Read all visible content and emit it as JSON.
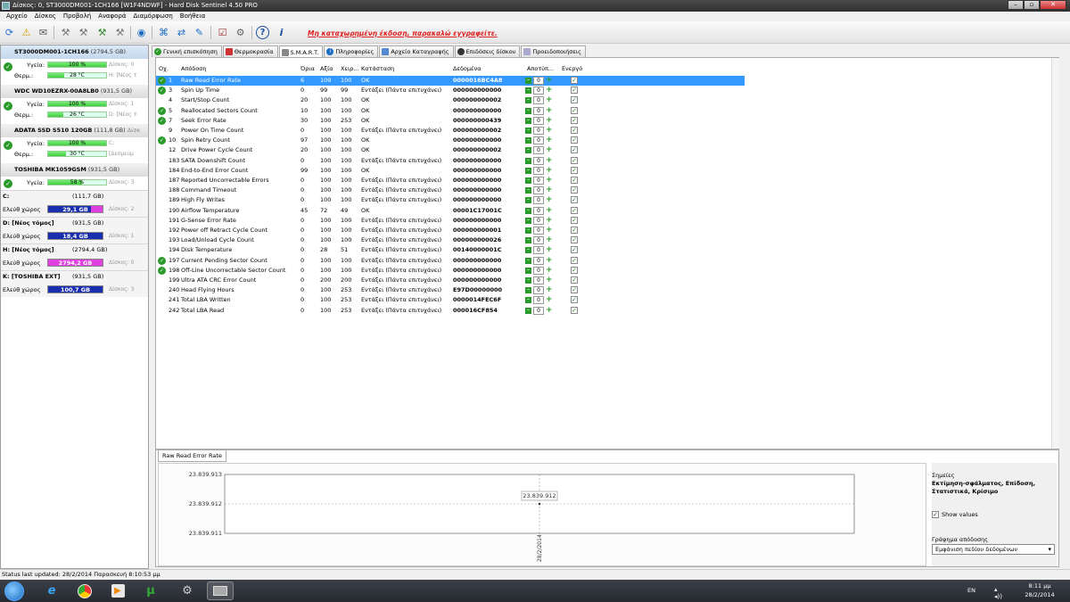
{
  "window": {
    "title": "Δίσκος: 0, ST3000DM001-1CH166 [W1F4NDWF]  -  Hard Disk Sentinel 4.50 PRO",
    "minimize": "–",
    "maximize": "▫",
    "close": "✕"
  },
  "menu": [
    "Αρχείο",
    "Δίσκος",
    "Προβολή",
    "Αναφορά",
    "Διαμόρφωση",
    "Βοήθεια"
  ],
  "toolbar": {
    "unregistered": "Μη καταχωρημένη έκδοση, παρακαλώ εγγραφείτε."
  },
  "disks": [
    {
      "name": "ST3000DM001-1CH166",
      "size": "(2794,5 GB)",
      "health_label": "Υγεία:",
      "health": "100 %",
      "health_pct": 100,
      "health_side": "Δίσκος: 0",
      "temp_label": "Θερμ.:",
      "temp": "28 °C",
      "temp_pct": 28,
      "temp_side": "H: [Νέος τ"
    },
    {
      "name": "WDC WD10EZRX-00A8LB0",
      "size": "(931,5 GB)",
      "health_label": "Υγεία:",
      "health": "100 %",
      "health_pct": 100,
      "health_side": "Δίσκος: 1",
      "temp_label": "Θερμ.:",
      "temp": "26 °C",
      "temp_pct": 26,
      "temp_side": "D: [Νέος τό"
    },
    {
      "name": "ADATA SSD S510 120GB",
      "size": "(111,8 GB)",
      "extra": "Δίσκ",
      "health_label": "Υγεία:",
      "health": "100 %",
      "health_pct": 100,
      "health_side": "C:",
      "temp_label": "Θερμ.:",
      "temp": "30 °C",
      "temp_pct": 30,
      "temp_side": "[Δεσμευμ"
    },
    {
      "name": "TOSHIBA MK1059GSM",
      "size": "(931,5 GB)",
      "health_label": "Υγεία:",
      "health": "58 %",
      "health_pct": 58,
      "health_side": "Δίσκος: 3"
    }
  ],
  "volumes": [
    {
      "name": "C:",
      "size": "(111,7 GB)",
      "free_label": "Ελεύθ χώρος",
      "free": "29,1 GB",
      "free_pct": 78,
      "disk": "Δίσκος: 2"
    },
    {
      "name": "D: [Νέος τόμος]",
      "size": "(931,5 GB)",
      "free_label": "Ελεύθ χώρος",
      "free": "18,4 GB",
      "free_pct": 100,
      "disk": "Δίσκος: 1"
    },
    {
      "name": "H: [Νέος τόμος]",
      "size": "(2794,4 GB)",
      "free_label": "Ελεύθ χώρος",
      "free": "2794,2 GB",
      "free_pct": 0,
      "disk": "Δίσκος: 0"
    },
    {
      "name": "K: [TOSHIBA EXT]",
      "size": "(931,5 GB)",
      "free_label": "Ελεύθ χώρος",
      "free": "100,7 GB",
      "free_pct": 100,
      "disk": "Δίσκος: 3"
    }
  ],
  "tabs": [
    "Γενική επισκόπηση",
    "Θερμοκρασία",
    "S.M.A.R.T.",
    "Πληροφορίες",
    "Αρχείο Καταγραφής",
    "Επιδόσεις δίσκου",
    "Προειδοποιήσεις"
  ],
  "columns": [
    "Οχ.",
    "Απόδοση",
    "Όρια",
    "Αξία",
    "Χειρ...",
    "Κατάσταση",
    "Δεδομένα",
    "Αποτύπ...",
    "Ενεργό"
  ],
  "rows": [
    {
      "id": "1",
      "name": "Raw Read Error Rate",
      "thr": "6",
      "val": "109",
      "worst": "100",
      "status": "OK",
      "data": "0000016BC4A8",
      "ok": true,
      "sel": true
    },
    {
      "id": "3",
      "name": "Spin Up Time",
      "thr": "0",
      "val": "99",
      "worst": "99",
      "status": "Εντάξει (Πάντα επιτυχάνει)",
      "data": "000000000000",
      "ok": true
    },
    {
      "id": "4",
      "name": "Start/Stop Count",
      "thr": "20",
      "val": "100",
      "worst": "100",
      "status": "OK",
      "data": "000000000002"
    },
    {
      "id": "5",
      "name": "Reallocated Sectors Count",
      "thr": "10",
      "val": "100",
      "worst": "100",
      "status": "OK",
      "data": "000000000000",
      "ok": true
    },
    {
      "id": "7",
      "name": "Seek Error Rate",
      "thr": "30",
      "val": "100",
      "worst": "253",
      "status": "OK",
      "data": "000000000439",
      "ok": true
    },
    {
      "id": "9",
      "name": "Power On Time Count",
      "thr": "0",
      "val": "100",
      "worst": "100",
      "status": "Εντάξει (Πάντα επιτυχάνει)",
      "data": "000000000002"
    },
    {
      "id": "10",
      "name": "Spin Retry Count",
      "thr": "97",
      "val": "100",
      "worst": "100",
      "status": "OK",
      "data": "000000000000",
      "ok": true
    },
    {
      "id": "12",
      "name": "Drive Power Cycle Count",
      "thr": "20",
      "val": "100",
      "worst": "100",
      "status": "OK",
      "data": "000000000002"
    },
    {
      "id": "183",
      "name": "SATA Downshift Count",
      "thr": "0",
      "val": "100",
      "worst": "100",
      "status": "Εντάξει (Πάντα επιτυχάνει)",
      "data": "000000000000"
    },
    {
      "id": "184",
      "name": "End-to-End Error Count",
      "thr": "99",
      "val": "100",
      "worst": "100",
      "status": "OK",
      "data": "000000000000"
    },
    {
      "id": "187",
      "name": "Reported Uncorrectable Errors",
      "thr": "0",
      "val": "100",
      "worst": "100",
      "status": "Εντάξει (Πάντα επιτυχάνει)",
      "data": "000000000000"
    },
    {
      "id": "188",
      "name": "Command Timeout",
      "thr": "0",
      "val": "100",
      "worst": "100",
      "status": "Εντάξει (Πάντα επιτυχάνει)",
      "data": "000000000000"
    },
    {
      "id": "189",
      "name": "High Fly Writes",
      "thr": "0",
      "val": "100",
      "worst": "100",
      "status": "Εντάξει (Πάντα επιτυχάνει)",
      "data": "000000000000"
    },
    {
      "id": "190",
      "name": "Airflow Temperature",
      "thr": "45",
      "val": "72",
      "worst": "49",
      "status": "OK",
      "data": "00001C17001C"
    },
    {
      "id": "191",
      "name": "G-Sense Error Rate",
      "thr": "0",
      "val": "100",
      "worst": "100",
      "status": "Εντάξει (Πάντα επιτυχάνει)",
      "data": "000000000000"
    },
    {
      "id": "192",
      "name": "Power off Retract Cycle Count",
      "thr": "0",
      "val": "100",
      "worst": "100",
      "status": "Εντάξει (Πάντα επιτυχάνει)",
      "data": "000000000001"
    },
    {
      "id": "193",
      "name": "Load/Unload Cycle Count",
      "thr": "0",
      "val": "100",
      "worst": "100",
      "status": "Εντάξει (Πάντα επιτυχάνει)",
      "data": "000000000026"
    },
    {
      "id": "194",
      "name": "Disk Temperature",
      "thr": "0",
      "val": "28",
      "worst": "51",
      "status": "Εντάξει (Πάντα επιτυχάνει)",
      "data": "00140000001C"
    },
    {
      "id": "197",
      "name": "Current Pending Sector Count",
      "thr": "0",
      "val": "100",
      "worst": "100",
      "status": "Εντάξει (Πάντα επιτυχάνει)",
      "data": "000000000000",
      "ok": true
    },
    {
      "id": "198",
      "name": "Off-Line Uncorrectable Sector Count",
      "thr": "0",
      "val": "100",
      "worst": "100",
      "status": "Εντάξει (Πάντα επιτυχάνει)",
      "data": "000000000000",
      "ok": true
    },
    {
      "id": "199",
      "name": "Ultra ATA CRC Error Count",
      "thr": "0",
      "val": "200",
      "worst": "200",
      "status": "Εντάξει (Πάντα επιτυχάνει)",
      "data": "000000000000"
    },
    {
      "id": "240",
      "name": "Head Flying Hours",
      "thr": "0",
      "val": "100",
      "worst": "253",
      "status": "Εντάξει (Πάντα επιτυχάνει)",
      "data": "E97D00000000"
    },
    {
      "id": "241",
      "name": "Total LBA Written",
      "thr": "0",
      "val": "100",
      "worst": "253",
      "status": "Εντάξει (Πάντα επιτυχάνει)",
      "data": "0000014FEC6F"
    },
    {
      "id": "242",
      "name": "Total LBA Read",
      "thr": "0",
      "val": "100",
      "worst": "253",
      "status": "Εντάξει (Πάντα επιτυχάνει)",
      "data": "000016CF854"
    }
  ],
  "row_threshold_value": "0",
  "graph": {
    "tab": "Raw Read Error Rate",
    "y_ticks": [
      "23.839.913",
      "23.839.912",
      "23.839.911"
    ],
    "point_label": "23.839.912",
    "x_label": "28/2/2014"
  },
  "chart_data": {
    "type": "line",
    "x": [
      "28/2/2014"
    ],
    "series": [
      {
        "values": [
          23839912
        ]
      }
    ],
    "ylim": [
      23839911,
      23839913
    ],
    "yticks": [
      23839913,
      23839912,
      23839911
    ],
    "grid": true
  },
  "notes": {
    "label": "Σημείες",
    "text": "Εκτίμηση-σφάλματος, Επίδοση, Στατιστικά, Κρίσιμο",
    "show_values": "Show values",
    "graph_label": "Γράφημα απόδοσης",
    "graph_select": "Εμφάνιση πεδίου δεδομένων"
  },
  "status": "Status last updated: 28/2/2014 Παρασκευή 8:10:53 μμ",
  "tray": {
    "lang": "EN",
    "time": "8:11 μμ",
    "date": "28/2/2014"
  }
}
